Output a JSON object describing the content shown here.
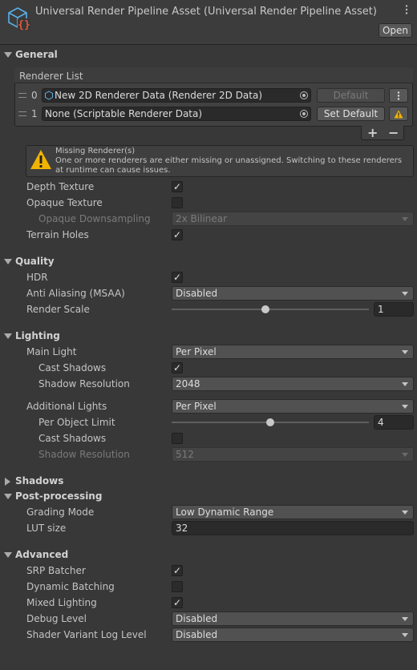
{
  "header": {
    "title": "Universal Render Pipeline Asset (Universal Render Pipeline Asset)",
    "open_label": "Open",
    "icon": "urp-asset-icon"
  },
  "general": {
    "label": "General",
    "renderer_list": {
      "label": "Renderer List",
      "items": [
        {
          "index": "0",
          "value": "New 2D Renderer Data (Renderer 2D Data)",
          "action": "Default",
          "action_enabled": false
        },
        {
          "index": "1",
          "value": "None (Scriptable Renderer Data)",
          "action": "Set Default",
          "warning": true
        }
      ],
      "add_label": "+",
      "remove_label": "−"
    },
    "warning": {
      "title": "Missing Renderer(s)",
      "message": "One or more renderers are either missing or unassigned.  Switching to these renderers at runtime can cause issues."
    },
    "depth_texture": {
      "label": "Depth Texture",
      "checked": true
    },
    "opaque_texture": {
      "label": "Opaque Texture",
      "checked": false
    },
    "opaque_downsampling": {
      "label": "Opaque Downsampling",
      "value": "2x Bilinear",
      "enabled": false
    },
    "terrain_holes": {
      "label": "Terrain Holes",
      "checked": true
    }
  },
  "quality": {
    "label": "Quality",
    "hdr": {
      "label": "HDR",
      "checked": true
    },
    "msaa": {
      "label": "Anti Aliasing (MSAA)",
      "value": "Disabled"
    },
    "render_scale": {
      "label": "Render Scale",
      "value": "1",
      "fraction": 1.0
    }
  },
  "lighting": {
    "label": "Lighting",
    "main_light": {
      "label": "Main Light",
      "value": "Per Pixel"
    },
    "main_cast_shadows": {
      "label": "Cast Shadows",
      "checked": true
    },
    "main_shadow_resolution": {
      "label": "Shadow Resolution",
      "value": "2048"
    },
    "additional_lights": {
      "label": "Additional Lights",
      "value": "Per Pixel"
    },
    "per_object_limit": {
      "label": "Per Object Limit",
      "value": "4",
      "fraction": 0.5
    },
    "add_cast_shadows": {
      "label": "Cast Shadows",
      "checked": false
    },
    "add_shadow_resolution": {
      "label": "Shadow Resolution",
      "value": "512",
      "enabled": false
    }
  },
  "shadows": {
    "label": "Shadows"
  },
  "post_processing": {
    "label": "Post-processing",
    "grading_mode": {
      "label": "Grading Mode",
      "value": "Low Dynamic Range"
    },
    "lut_size": {
      "label": "LUT size",
      "value": "32"
    }
  },
  "advanced": {
    "label": "Advanced",
    "srp_batcher": {
      "label": "SRP Batcher",
      "checked": true
    },
    "dynamic_batching": {
      "label": "Dynamic Batching",
      "checked": false
    },
    "mixed_lighting": {
      "label": "Mixed Lighting",
      "checked": true
    },
    "debug_level": {
      "label": "Debug Level",
      "value": "Disabled"
    },
    "shader_variant_log_level": {
      "label": "Shader Variant Log Level",
      "value": "Disabled"
    }
  },
  "colors": {
    "background": "#383838",
    "warning": "#f0b400",
    "text": "#c4c4c4"
  }
}
